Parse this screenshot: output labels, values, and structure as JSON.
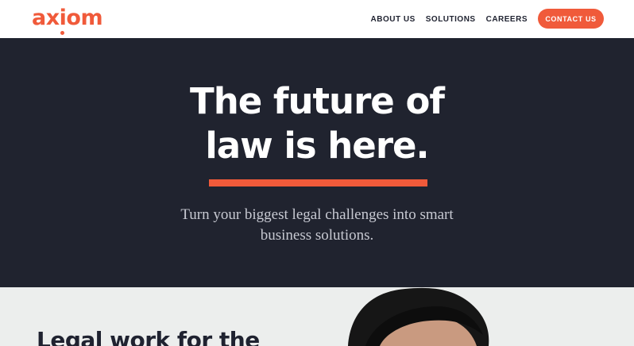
{
  "brand": {
    "logo_text": "axiom",
    "accent_color": "#f05a3a"
  },
  "nav": {
    "links": [
      "ABOUT US",
      "SOLUTIONS",
      "CAREERS"
    ],
    "cta_label": "CONTACT US"
  },
  "hero": {
    "title_line1": "The future of",
    "title_line2": "law is here.",
    "subtitle": "Turn your biggest legal challenges into smart business solutions.",
    "background_color": "#20232f"
  },
  "section": {
    "heading": "Legal work for the"
  }
}
